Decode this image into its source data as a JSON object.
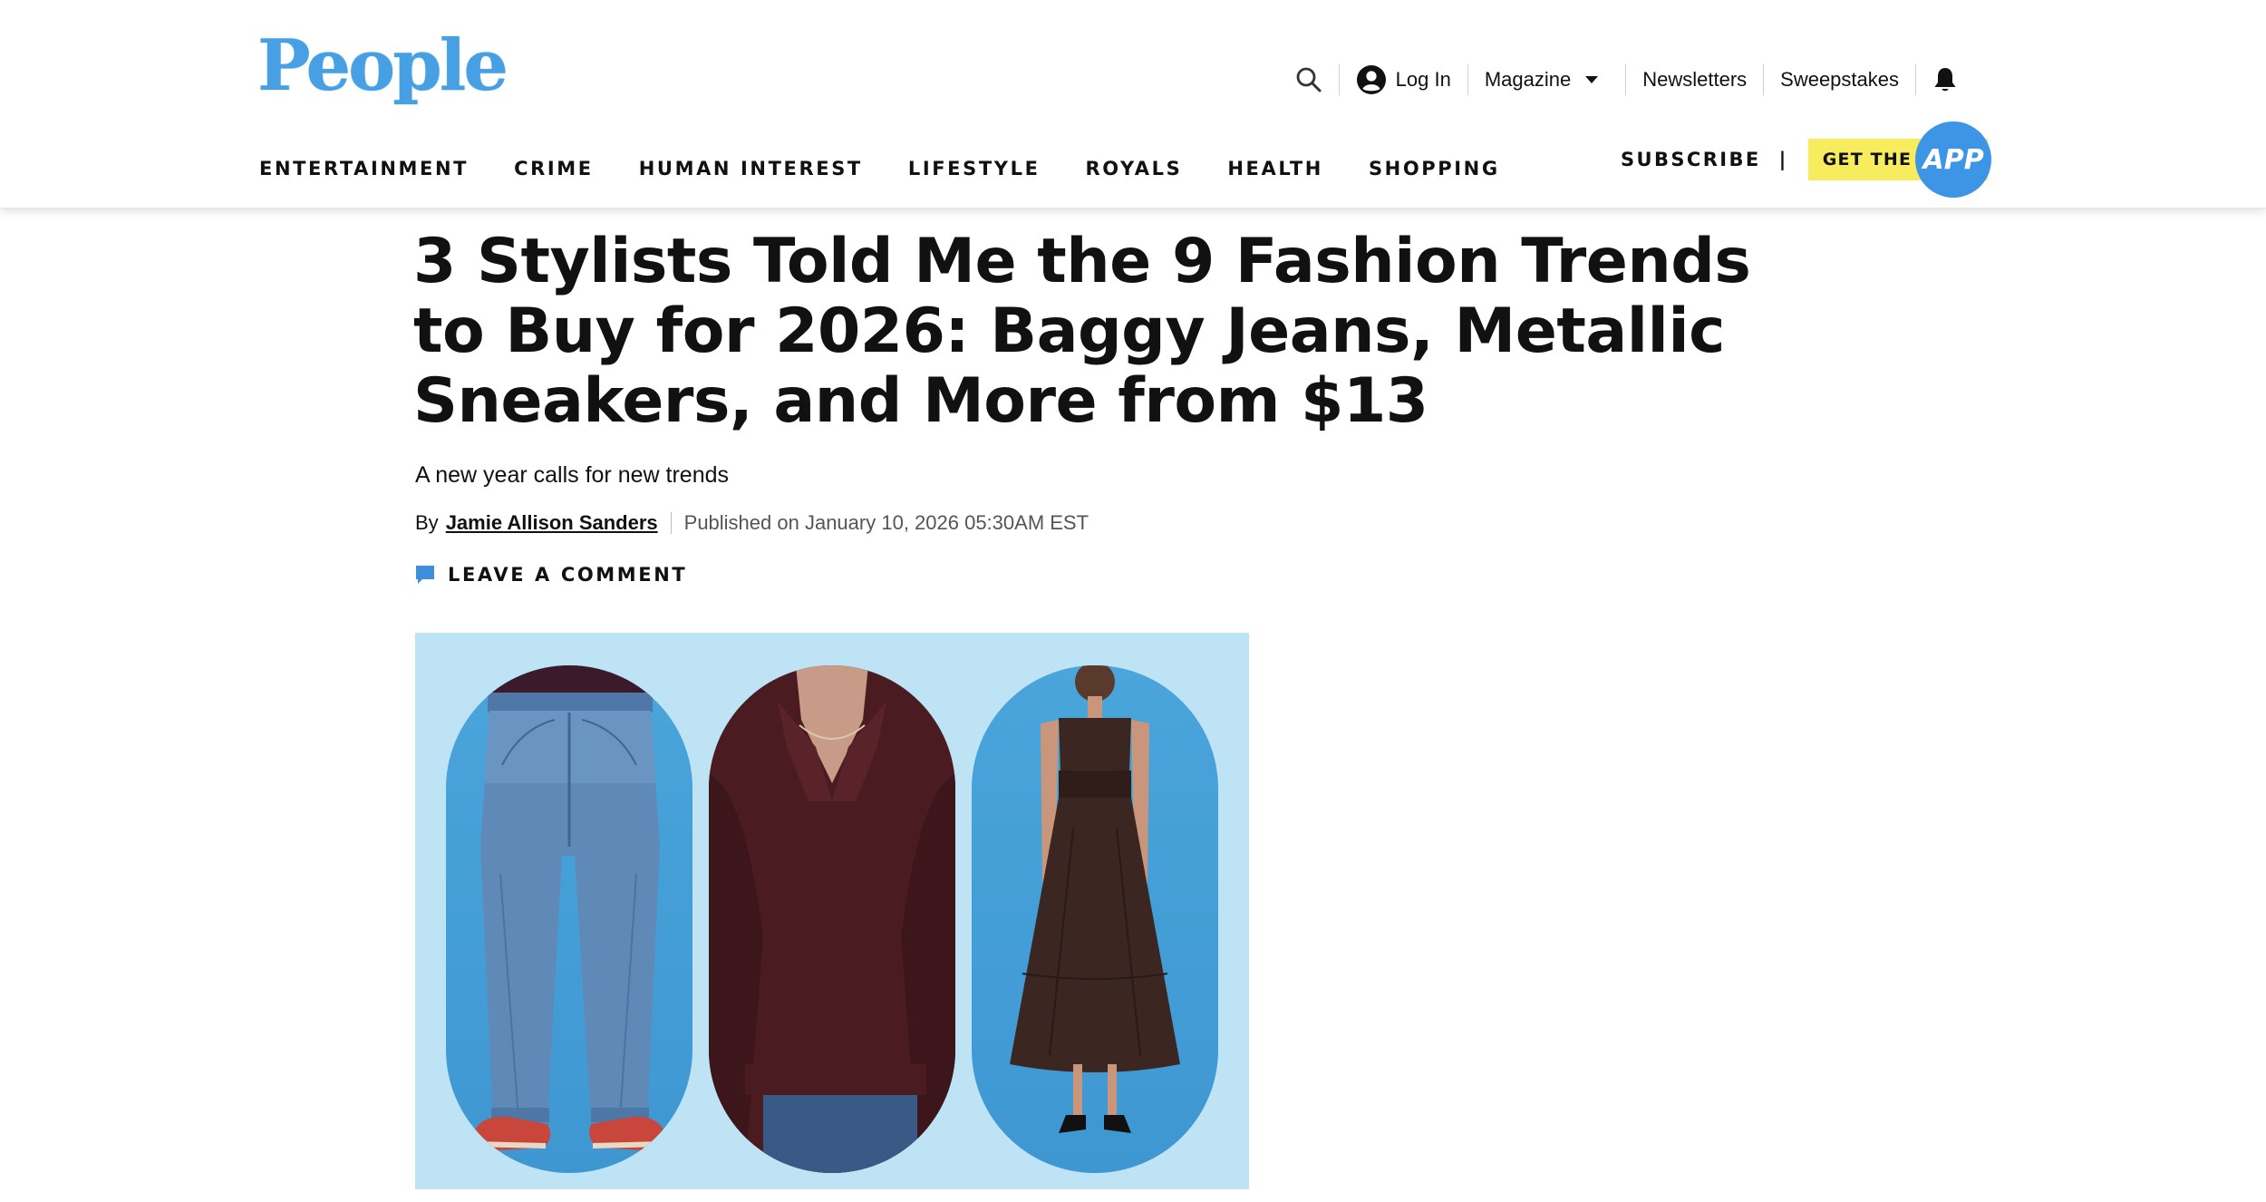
{
  "header": {
    "logo": "People",
    "utility": {
      "login_label": "Log In",
      "magazine_label": "Magazine",
      "newsletters_label": "Newsletters",
      "sweepstakes_label": "Sweepstakes"
    },
    "nav": [
      "ENTERTAINMENT",
      "CRIME",
      "HUMAN INTEREST",
      "LIFESTYLE",
      "ROYALS",
      "HEALTH",
      "SHOPPING"
    ],
    "subscribe_label": "SUBSCRIBE",
    "subscribe_separator": "|",
    "get_app_label": "GET THE",
    "app_badge": "APP"
  },
  "article": {
    "headline": "3 Stylists Told Me the 9 Fashion Trends to Buy for 2026: Baggy Jeans, Metallic Sneakers, and More from $13",
    "dek": "A new year calls for new trends",
    "by_prefix": "By",
    "author": "Jamie Allison Sanders",
    "published": "Published on January 10, 2026 05:30AM EST",
    "comment_label": "LEAVE A COMMENT"
  },
  "colors": {
    "brand_blue": "#46a0e3",
    "app_pill": "#f6ec5e",
    "app_circle": "#3d95e6",
    "hero_bg": "#bee3f5",
    "comment_icon": "#3d8fd9"
  },
  "icons": [
    "search-icon",
    "user-circle-icon",
    "chevron-down-icon",
    "bell-icon",
    "comment-icon"
  ]
}
